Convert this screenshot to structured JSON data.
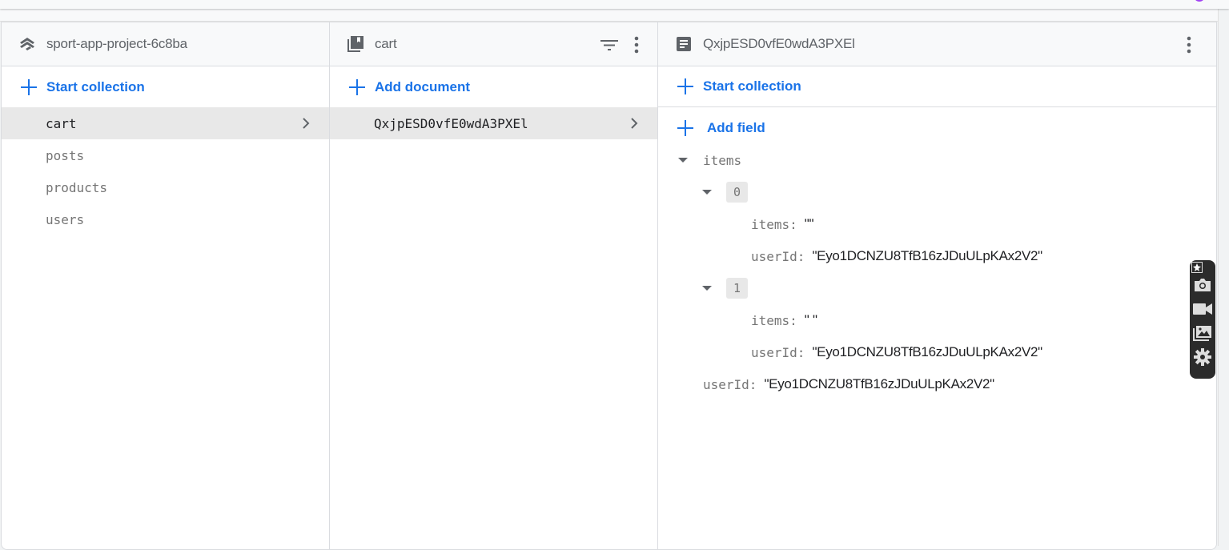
{
  "colors": {
    "accent": "#1a73e8",
    "selected_bg": "#e8e8e8",
    "header_bg": "#f8f9fa",
    "muted_text": "#757575",
    "strong_text": "#202124"
  },
  "root_column": {
    "icon": "project-layers-icon",
    "title": "sport-app-project-6c8ba",
    "action_label": "Start collection",
    "collections": [
      {
        "name": "cart",
        "selected": true
      },
      {
        "name": "posts",
        "selected": false
      },
      {
        "name": "products",
        "selected": false
      },
      {
        "name": "users",
        "selected": false
      }
    ]
  },
  "collection_column": {
    "icon": "collection-icon",
    "title": "cart",
    "filter_icon": "filter-icon",
    "menu_icon": "more-vert-icon",
    "action_label": "Add document",
    "documents": [
      {
        "id": "QxjpESD0vfE0wdA3PXEl",
        "selected": true
      }
    ]
  },
  "document_column": {
    "icon": "document-icon",
    "title": "QxjpESD0vfE0wdA3PXEl",
    "menu_icon": "more-vert-icon",
    "start_collection_label": "Start collection",
    "add_field_label": "Add field",
    "fields": {
      "items_key": "items",
      "item0_index": "0",
      "item0_items_key": "items:",
      "item0_items_value": "\"\"",
      "item0_userId_key": "userId:",
      "item0_userId_value": "\"Eyo1DCNZU8TfB16zJDuULpKAx2V2\"",
      "item1_index": "1",
      "item1_items_key": "items:",
      "item1_items_value": "\" \"",
      "item1_userId_key": "userId:",
      "item1_userId_value": "\"Eyo1DCNZU8TfB16zJDuULpKAx2V2\"",
      "userId_key": "userId:",
      "userId_value": "\"Eyo1DCNZU8TfB16zJDuULpKAx2V2\""
    }
  },
  "capture_widget": {
    "buttons": [
      "pin-icon",
      "camera-icon",
      "video-icon",
      "gallery-icon",
      "settings-icon"
    ]
  }
}
